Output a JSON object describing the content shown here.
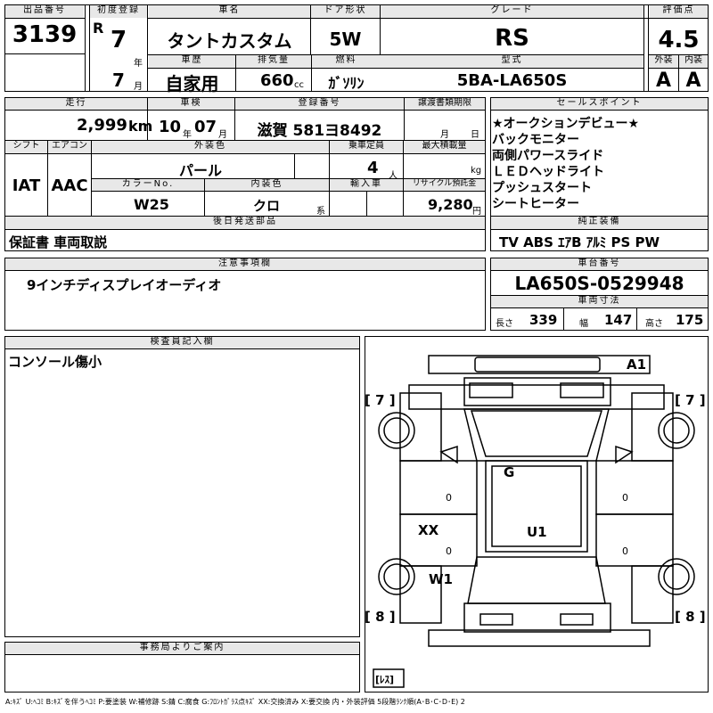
{
  "header": {
    "lot_label": "出品番号",
    "lot": "3139",
    "first_reg_label": "初度登録",
    "era": "R",
    "first_reg_year": "7",
    "year_unit": "年",
    "first_reg_month": "7",
    "month_unit": "月",
    "car_name_label": "車名",
    "car_name": "タントカスタム",
    "door_label": "ドア形状",
    "door": "5W",
    "grade_label": "グレード",
    "grade": "RS",
    "score_label": "評価点",
    "score": "4.5",
    "history_label": "車歴",
    "history": "自家用",
    "displacement_label": "排気量",
    "displacement": "660",
    "displacement_unit": "cc",
    "fuel_label": "燃料",
    "fuel": "ｶﾞｿﾘﾝ",
    "model_label": "型式",
    "model": "5BA-LA650S",
    "ext_label": "外装",
    "ext_grade": "A",
    "int_label": "内装",
    "int_grade": "A"
  },
  "row2": {
    "mileage_label": "走行",
    "mileage": "2,999",
    "mileage_unit": "km",
    "inspection_label": "車検",
    "insp_year": "10",
    "insp_year_unit": "年",
    "insp_month": "07",
    "insp_month_unit": "月",
    "reg_label": "登録番号",
    "reg_plate": "滋賀 581ヨ8492",
    "transfer_label": "譲渡書類期限",
    "transfer_month_unit": "月",
    "transfer_day_unit": "日",
    "shift_label": "シフト",
    "shift": "IAT",
    "ac_label": "エアコン",
    "ac": "AAC",
    "ext_color_label": "外装色",
    "ext_color": "パール",
    "capacity_label": "乗車定員",
    "capacity": "4",
    "capacity_unit": "人",
    "max_load_label": "最大積載量",
    "max_load_unit": "kg",
    "color_no_label": "カラーNo.",
    "color_no": "W25",
    "int_color_label": "内装色",
    "int_color": "クロ",
    "int_color_unit": "系",
    "import_label": "輸入車",
    "recycle_label": "リサイクル預託金",
    "recycle": "9,280",
    "recycle_unit": "円",
    "delivery_label": "後日発送部品",
    "delivery": "保証書 車両取説"
  },
  "sales_points": {
    "label": "セールスポイント",
    "items": [
      "★オークションデビュー★",
      "バックモニター",
      "両側パワースライド",
      "ＬＥＤヘッドライト",
      "プッシュスタート",
      "シートヒーター"
    ]
  },
  "equipment": {
    "label": "純正装備",
    "value": "TV ABS ｴｱB ｱﾙﾐ PS PW"
  },
  "notes": {
    "label": "注意事項欄",
    "value": "9インチディスプレイオーディオ"
  },
  "chassis": {
    "label": "車台番号",
    "value": "LA650S-0529948",
    "dims_label": "車両寸法",
    "length_label": "長さ",
    "length": "339",
    "width_label": "幅",
    "width": "147",
    "height_label": "高さ",
    "height": "175"
  },
  "inspector": {
    "label": "検査員記入欄",
    "value": "コンソール傷小"
  },
  "office": {
    "label": "事務局よりご案内"
  },
  "diagram": {
    "marks": {
      "a1": "A1",
      "g": "G",
      "xx": "XX",
      "u1": "U1",
      "w1": "W1"
    },
    "tire_fl": "[ 7 ]",
    "tire_fr": "[ 7 ]",
    "tire_rl": "[ 8 ]",
    "tire_rr": "[ 8 ]",
    "spare": "[ﾚｽ]",
    "tire_zero": "0"
  },
  "legend": "A:ｷｽﾞ U:ﾍｺﾐ B:ｷｽﾞを伴うﾍｺﾐ P:要塗装 W:補修跡 S:錆 C:腐食 G:ﾌﾛﾝﾄｶﾞﾗｽ点ｷｽﾞ XX:交換済み X:要交換 内・外装評価 5段階ﾗﾝｸ順(A･B･C･D･E) 2"
}
